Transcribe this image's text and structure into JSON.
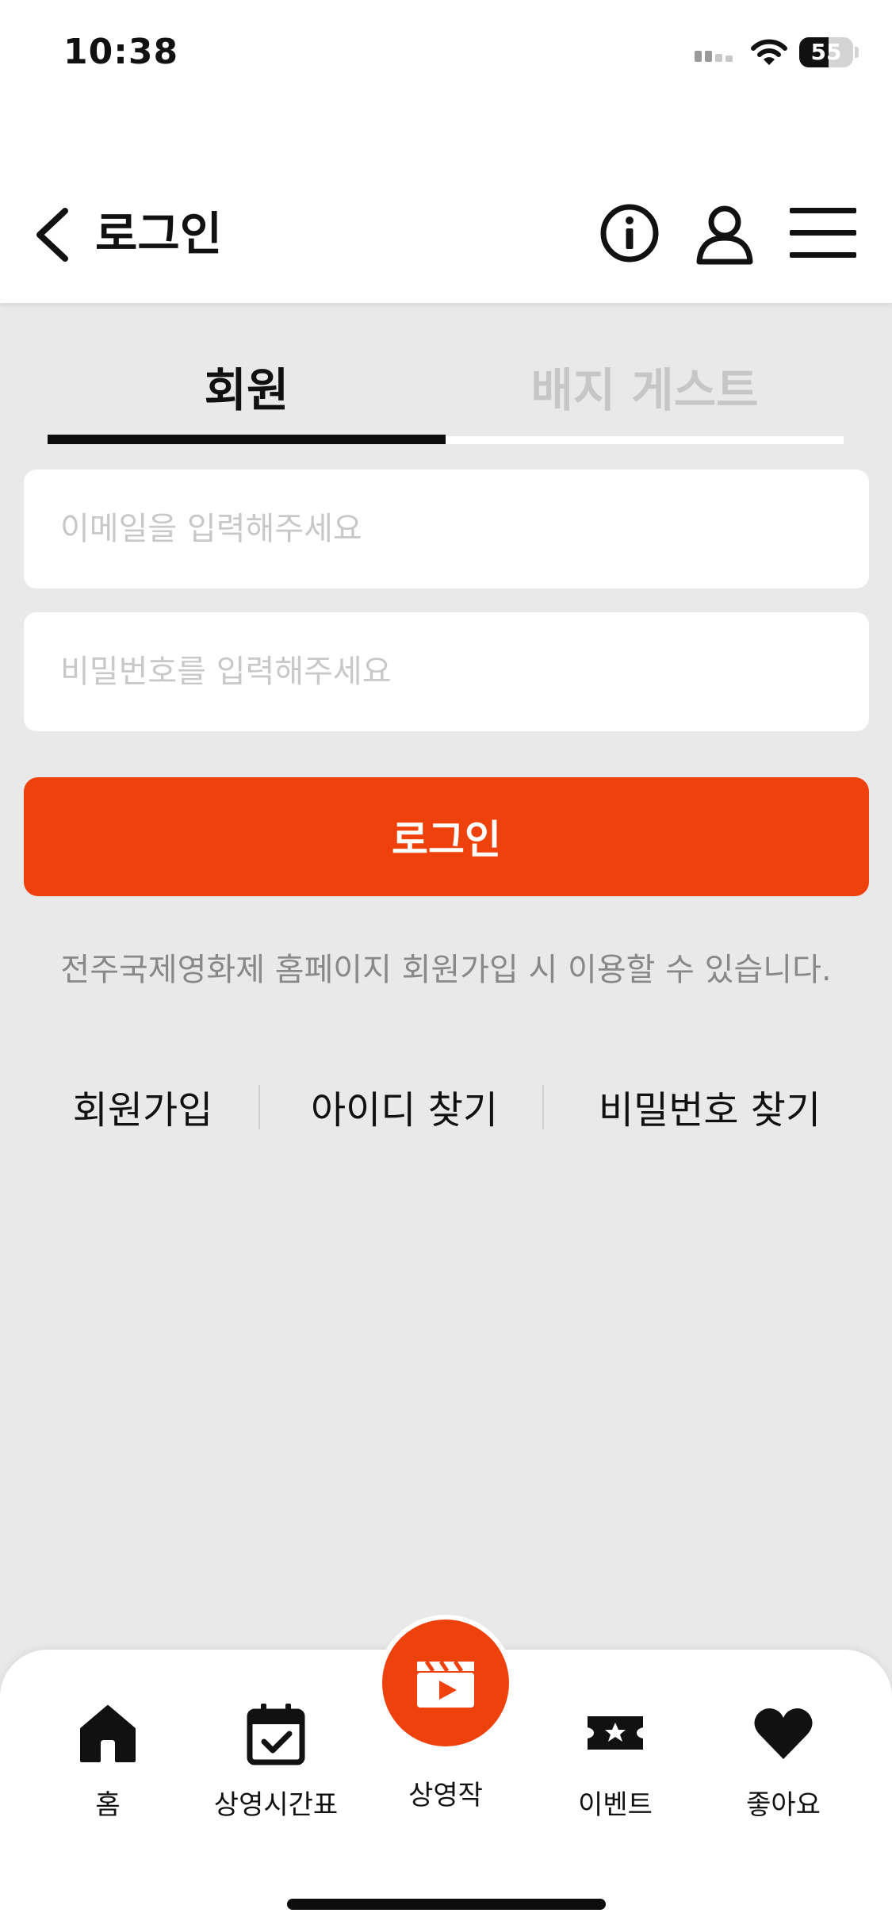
{
  "status_bar": {
    "time": "10:38",
    "battery": "55",
    "battery_level_percent": 55
  },
  "header": {
    "title": "로그인",
    "icons": [
      "back-icon",
      "info-icon",
      "user-icon",
      "menu-icon"
    ]
  },
  "tabs": [
    {
      "label": "회원",
      "active": true
    },
    {
      "label": "배지 게스트",
      "active": false
    }
  ],
  "form": {
    "email_placeholder": "이메일을 입력해주세요",
    "password_placeholder": "비밀번호를 입력해주세요",
    "login_label": "로그인",
    "notice": "전주국제영화제 홈페이지 회원가입 시 이용할 수 있습니다."
  },
  "links": {
    "signup": "회원가입",
    "find_id": "아이디 찾기",
    "find_password": "비밀번호 찾기"
  },
  "bottom_nav": {
    "items": [
      {
        "label": "홈",
        "icon": "home-icon"
      },
      {
        "label": "상영시간표",
        "icon": "calendar-check-icon"
      },
      {
        "label": "상영작",
        "icon": "clapperboard-icon"
      },
      {
        "label": "이벤트",
        "icon": "ticket-star-icon"
      },
      {
        "label": "좋아요",
        "icon": "heart-icon"
      }
    ]
  },
  "colors": {
    "accent": "#ef410b",
    "background": "#e9e9e9"
  }
}
